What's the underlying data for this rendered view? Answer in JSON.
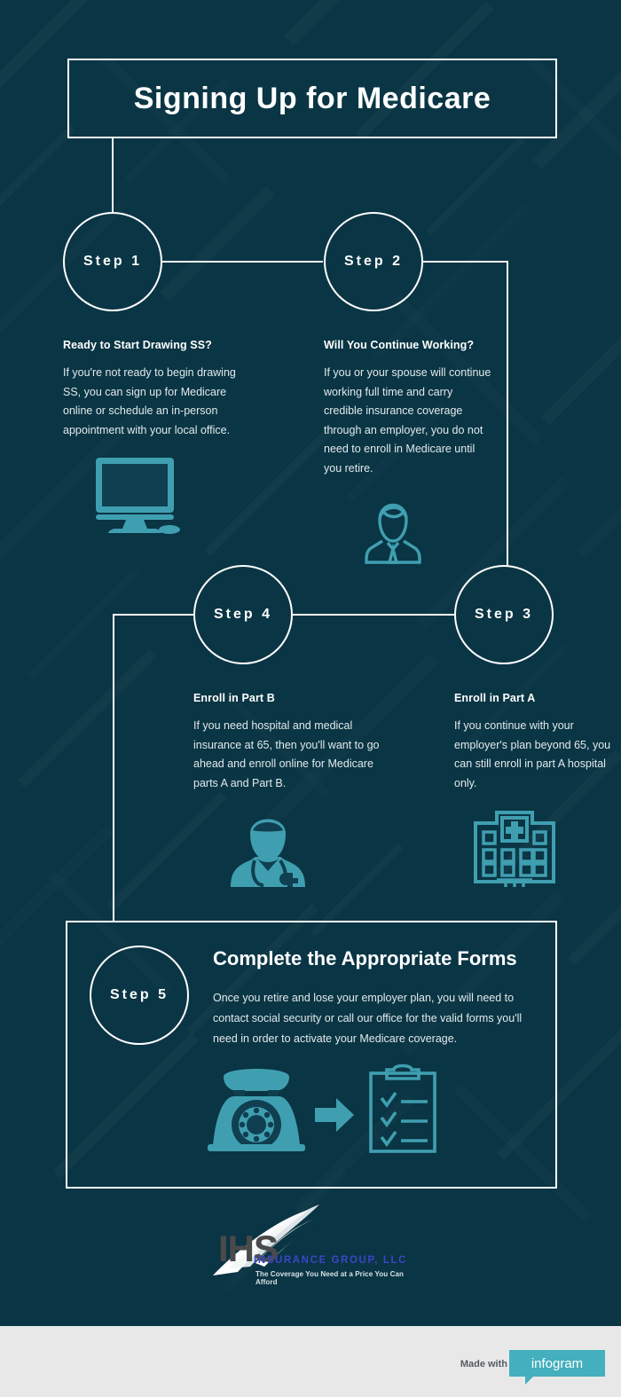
{
  "header": {
    "title": "Signing Up for Medicare"
  },
  "steps": [
    {
      "badge": "Step 1",
      "heading": "Ready to Start Drawing SS?",
      "body": "If you're not ready to begin drawing SS, you can sign up for Medicare online or schedule an in-person appointment with your local office.",
      "icon": "desktop-computer-icon"
    },
    {
      "badge": "Step 2",
      "heading": "Will You Continue Working?",
      "body": "If you or your spouse will continue working full time and carry credible insurance coverage through an employer, you do not need to enroll in Medicare  until you retire.",
      "icon": "businessman-icon"
    },
    {
      "badge": "Step 3",
      "heading": "Enroll in Part A",
      "body": "If you continue with your employer's plan beyond 65, you can still enroll in part A hospital only.",
      "icon": "hospital-building-icon"
    },
    {
      "badge": "Step 4",
      "heading": "Enroll in Part B",
      "body": "If you need hospital and medical insurance at 65, then you'll want to go ahead and enroll online for Medicare parts A and Part B.",
      "icon": "doctor-icon"
    },
    {
      "badge": "Step 5",
      "heading": "Complete the Appropriate Forms",
      "body": "Once you retire and lose your employer plan, you will need to contact social security or call our office for the valid forms you'll need in order to activate your Medicare coverage.",
      "icon": "telephone-arrow-clipboard-icon"
    }
  ],
  "logo": {
    "mark": "IHS",
    "name": "INSURANCE GROUP, LLC",
    "tagline": "The Coverage You Need at a Price You Can Afford"
  },
  "footer": {
    "made_with": "Made with",
    "brand": "infogram"
  },
  "colors": {
    "background": "#0a3544",
    "line": "#ffffff",
    "accent_icon": "#3f9fb0",
    "icon_dark": "#0f3f50",
    "footer_bg": "#e8e8e8",
    "footer_badge": "#44afbd",
    "logo_blue": "#3a46c8",
    "logo_gray": "#4a4a4a"
  }
}
